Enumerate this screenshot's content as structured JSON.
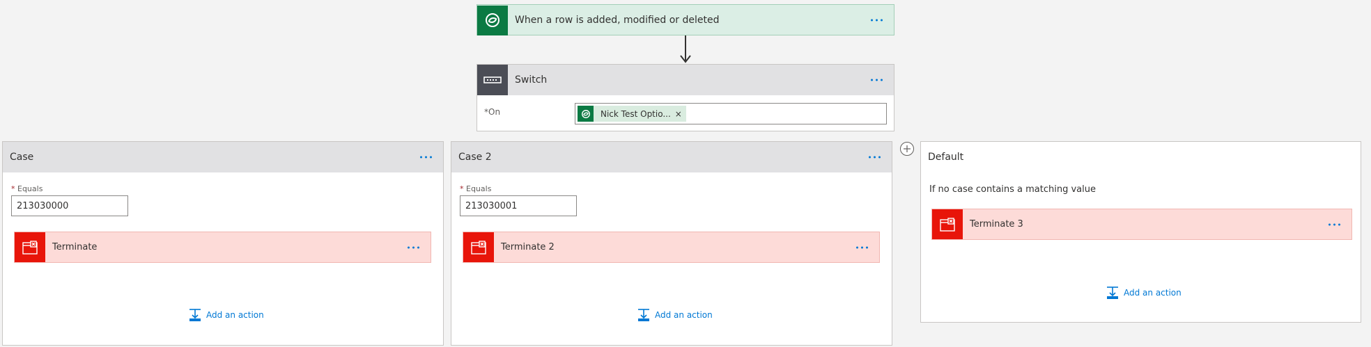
{
  "trigger": {
    "title": "When a row is added, modified or deleted",
    "icon": "dataverse-icon"
  },
  "switch": {
    "title": "Switch",
    "icon": "switch-icon",
    "on_required": "*",
    "on_label": "On",
    "token": {
      "label": "Nick Test Optio...",
      "remove": "×"
    }
  },
  "cases": [
    {
      "title": "Case",
      "equals_required": "*",
      "equals_label": "Equals",
      "value": "213030000",
      "action": "Terminate",
      "add_action": "Add an action"
    },
    {
      "title": "Case 2",
      "equals_required": "*",
      "equals_label": "Equals",
      "value": "213030001",
      "action": "Terminate 2",
      "add_action": "Add an action"
    }
  ],
  "default": {
    "title": "Default",
    "description": "If no case contains a matching value",
    "action": "Terminate 3",
    "add_action": "Add an action"
  },
  "colors": {
    "trigger_icon_bg": "#0b7a43",
    "trigger_bg": "#dbeee5",
    "switch_icon_bg": "#4b4d56",
    "terminate_icon_bg": "#e8150a",
    "terminate_bg": "#fddbd8",
    "accent": "#0078d4"
  }
}
